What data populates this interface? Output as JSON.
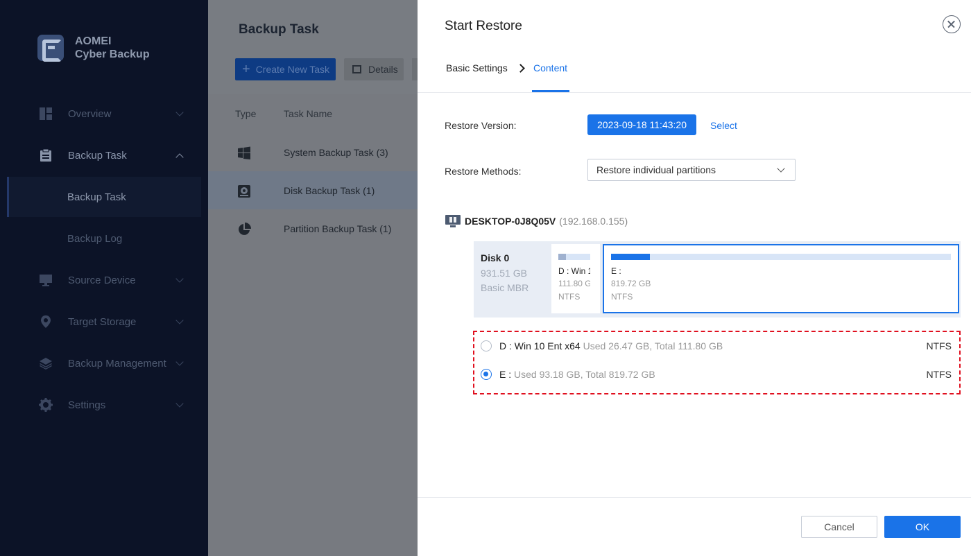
{
  "app": {
    "brand_line1": "AOMEI",
    "brand_line2": "Cyber Backup"
  },
  "sidebar": {
    "items": [
      {
        "label": "Overview",
        "icon": "dashboard-icon"
      },
      {
        "label": "Backup Task",
        "icon": "clipboard-icon",
        "expanded": true
      },
      {
        "label": "Source Device",
        "icon": "monitor-icon"
      },
      {
        "label": "Target Storage",
        "icon": "location-pin-icon"
      },
      {
        "label": "Backup Management",
        "icon": "layers-icon"
      },
      {
        "label": "Settings",
        "icon": "gear-icon"
      }
    ],
    "sub_items": [
      {
        "label": "Backup Task",
        "active": true
      },
      {
        "label": "Backup Log",
        "active": false
      }
    ]
  },
  "main": {
    "title": "Backup Task",
    "create_label": "Create New Task",
    "details_label": "Details",
    "columns": [
      "Type",
      "Task Name"
    ],
    "rows": [
      {
        "name": "System Backup Task (3)",
        "icon": "windows-icon"
      },
      {
        "name": "Disk Backup Task (1)",
        "icon": "disk-icon",
        "selected": true
      },
      {
        "name": "Partition Backup Task (1)",
        "icon": "pie-icon"
      }
    ]
  },
  "drawer": {
    "title": "Start Restore",
    "steps": {
      "basic": "Basic Settings",
      "content": "Content"
    },
    "restore_version_label": "Restore Version:",
    "restore_version_value": "2023-09-18 11:43:20",
    "select_label": "Select",
    "restore_methods_label": "Restore Methods:",
    "restore_method_value": "Restore individual partitions",
    "device": {
      "name": "DESKTOP-0J8Q05V",
      "ip": "(192.168.0.155)"
    },
    "disk": {
      "name": "Disk 0",
      "size": "931.51 GB",
      "type": "Basic MBR",
      "partitions": [
        {
          "label": "D : Win 10 Ent x64",
          "size": "111.80 GB",
          "fs": "NTFS",
          "used_fraction": 0.237
        },
        {
          "label": "E :",
          "size": "819.72 GB",
          "fs": "NTFS",
          "used_fraction": 0.114
        }
      ]
    },
    "choices": [
      {
        "label": "D : Win 10 Ent x64",
        "info": "Used 26.47 GB, Total 111.80 GB",
        "fs": "NTFS",
        "selected": false
      },
      {
        "label": "E :",
        "info": "Used 93.18 GB, Total 819.72 GB",
        "fs": "NTFS",
        "selected": true
      }
    ],
    "cancel_label": "Cancel",
    "ok_label": "OK"
  },
  "colors": {
    "accent": "#1a73e8",
    "sidebar_bg": "#0c1327",
    "highlight_dash": "#e0101f"
  }
}
